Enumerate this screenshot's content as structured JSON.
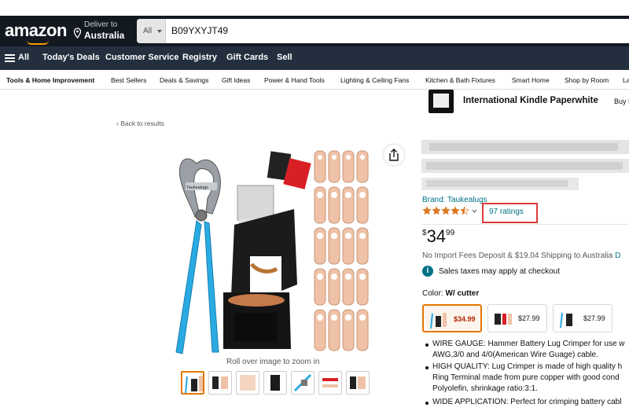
{
  "header": {
    "logo": "amazon",
    "deliver_line1": "Deliver to",
    "deliver_line2": "Australia",
    "search_category": "All",
    "search_value": "B09YXYJT49"
  },
  "main_nav": {
    "menu_label": "All",
    "items": [
      "Today's Deals",
      "Customer Service",
      "Registry",
      "Gift Cards",
      "Sell"
    ]
  },
  "sub_nav": {
    "items": [
      "Tools & Home Improvement",
      "Best Sellers",
      "Deals & Savings",
      "Gift Ideas",
      "Power & Hand Tools",
      "Lighting & Ceiling Fans",
      "Kitchen & Bath Fixtures",
      "Smart Home",
      "Shop by Room",
      "La"
    ]
  },
  "promo": {
    "title": "International Kindle Paperwhite",
    "button": "Buy N"
  },
  "back_link": "‹ Back to results",
  "gallery": {
    "rollover_hint": "Roll over image to zoom in",
    "thumb_count": 7
  },
  "product": {
    "brand": "Brand: Taukealugs",
    "rating_value": 4.5,
    "ratings_count": "97 ratings",
    "price_currency": "$",
    "price_whole": "34",
    "price_fraction": "99",
    "import_text": "No Import Fees Deposit & $19.04 Shipping to Australia",
    "import_link": "D",
    "tax_text": "Sales taxes may apply at checkout",
    "color_label": "Color:",
    "color_value": "W/ cutter",
    "options": [
      {
        "price": "$34.99",
        "selected": true
      },
      {
        "price": "$27.99",
        "selected": false
      },
      {
        "price": "$27.99",
        "selected": false
      }
    ],
    "bullets": [
      "WIRE GAUGE: Hammer Battery Lug Crimper for use w",
      "AWG,3/0 and 4/0(American Wire Guage) cable.",
      "HIGH QUALITY: Lug Crimper is made of high quality h",
      "Ring Terminal made from pure copper with good cond",
      "Polyolefin, shrinkage ratio:3:1.",
      "WIDE APPLICATION: Perfect for crimping battery cabl"
    ]
  },
  "colors": {
    "nav_dark": "#131921",
    "nav_mid": "#232f3e",
    "accent_orange": "#ff9900",
    "link": "#007185",
    "price_red": "#b12704",
    "highlight_box": "#e03a3a"
  }
}
